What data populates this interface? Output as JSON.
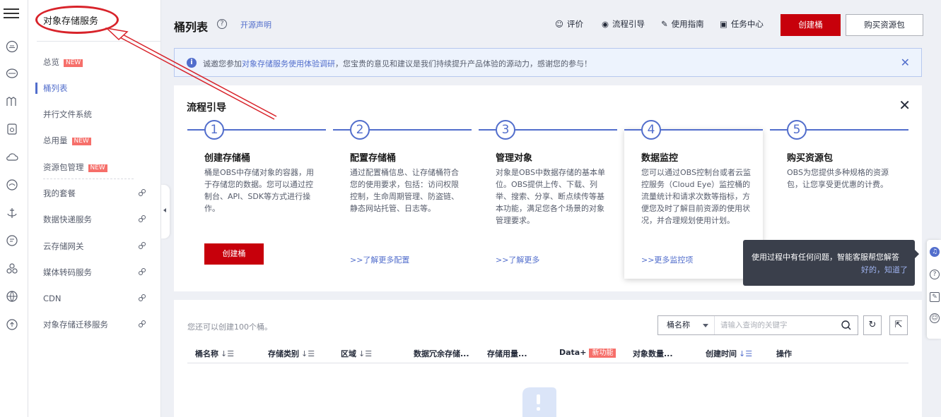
{
  "sidebar": {
    "title": "对象存储服务",
    "items": [
      {
        "label": "总览",
        "badge": "NEW"
      },
      {
        "label": "桶列表",
        "active": true
      },
      {
        "label": "并行文件系统"
      },
      {
        "label": "总用量",
        "badge": "NEW"
      },
      {
        "label": "资源包管理",
        "badge": "NEW"
      },
      {
        "label": "我的套餐",
        "external": true
      },
      {
        "label": "数据快递服务",
        "external": true
      },
      {
        "label": "云存储网关",
        "external": true
      },
      {
        "label": "媒体转码服务",
        "external": true
      },
      {
        "label": "CDN",
        "external": true
      },
      {
        "label": "对象存储迁移服务",
        "external": true
      }
    ]
  },
  "header": {
    "title": "桶列表",
    "open_source_link": "开源声明",
    "actions": [
      "评价",
      "流程引导",
      "使用指南",
      "任务中心"
    ],
    "create_button": "创建桶",
    "buy_button": "购买资源包"
  },
  "notice": {
    "text_before": "诚邀您参加",
    "link": "对象存储服务使用体验调研",
    "text_after": "，您宝贵的意见和建议是我们持续提升产品体验的源动力，感谢您的参与！"
  },
  "guide": {
    "title": "流程引导",
    "steps": [
      {
        "num": "1",
        "title": "创建存储桶",
        "desc": "桶是OBS中存储对象的容器，用于存储您的数据。您可以通过控制台、API、SDK等方式进行操作。",
        "button": "创建桶"
      },
      {
        "num": "2",
        "title": "配置存储桶",
        "desc": "通过配置桶信息、让存储桶符合您的使用要求，包括：访问权限控制，生命周期管理、防盗链、静态网站托管、日志等。",
        "link": ">>了解更多配置"
      },
      {
        "num": "3",
        "title": "管理对象",
        "desc": "对象是OBS中数据存储的基本单位。OBS提供上传、下载、列举、搜索、分享、断点续传等基本功能，满足您各个场景的对象管理要求。",
        "link": ">>了解更多"
      },
      {
        "num": "4",
        "title": "数据监控",
        "desc": "您可以通过OBS控制台或者云监控服务（Cloud Eye）监控桶的流量统计和请求次数等指标，方便您及时了解目前资源的使用状况，并合理规划使用计划。",
        "link": ">>更多监控项"
      },
      {
        "num": "5",
        "title": "购买资源包",
        "desc": "OBS为您提供多种规格的资源包，让您享受更优惠的计费。"
      }
    ]
  },
  "tooltip": {
    "text": "使用过程中有任何问题，智能客服帮您解答",
    "dismiss": "好的，知道了"
  },
  "list": {
    "quota_text": "您还可以创建100个桶。",
    "search_field": "桶名称",
    "search_placeholder": "请输入查询的关键字",
    "columns": [
      "桶名称",
      "存储类别",
      "区域",
      "数据冗余存储...",
      "存储用量...",
      "Data+",
      "对象数量...",
      "创建时间",
      "操作"
    ],
    "new_feature_badge": "新功能"
  },
  "colors": {
    "brand_red": "#c7000b",
    "accent_blue": "#526ecc",
    "annotation_red": "#d8232a",
    "new_badge": "#f66f6a"
  },
  "icons": {
    "rail": [
      "menu-icon",
      "cloud-icon",
      "database-icon",
      "cluster-icon",
      "disk-icon",
      "cloud-outline-icon",
      "cloud-loop-icon",
      "anchor-icon",
      "tag-icon",
      "nodes-icon",
      "globe-icon",
      "cloud-upload-icon"
    ],
    "float": [
      "headset-icon",
      "help-icon",
      "feedback-icon",
      "smile-icon"
    ]
  }
}
